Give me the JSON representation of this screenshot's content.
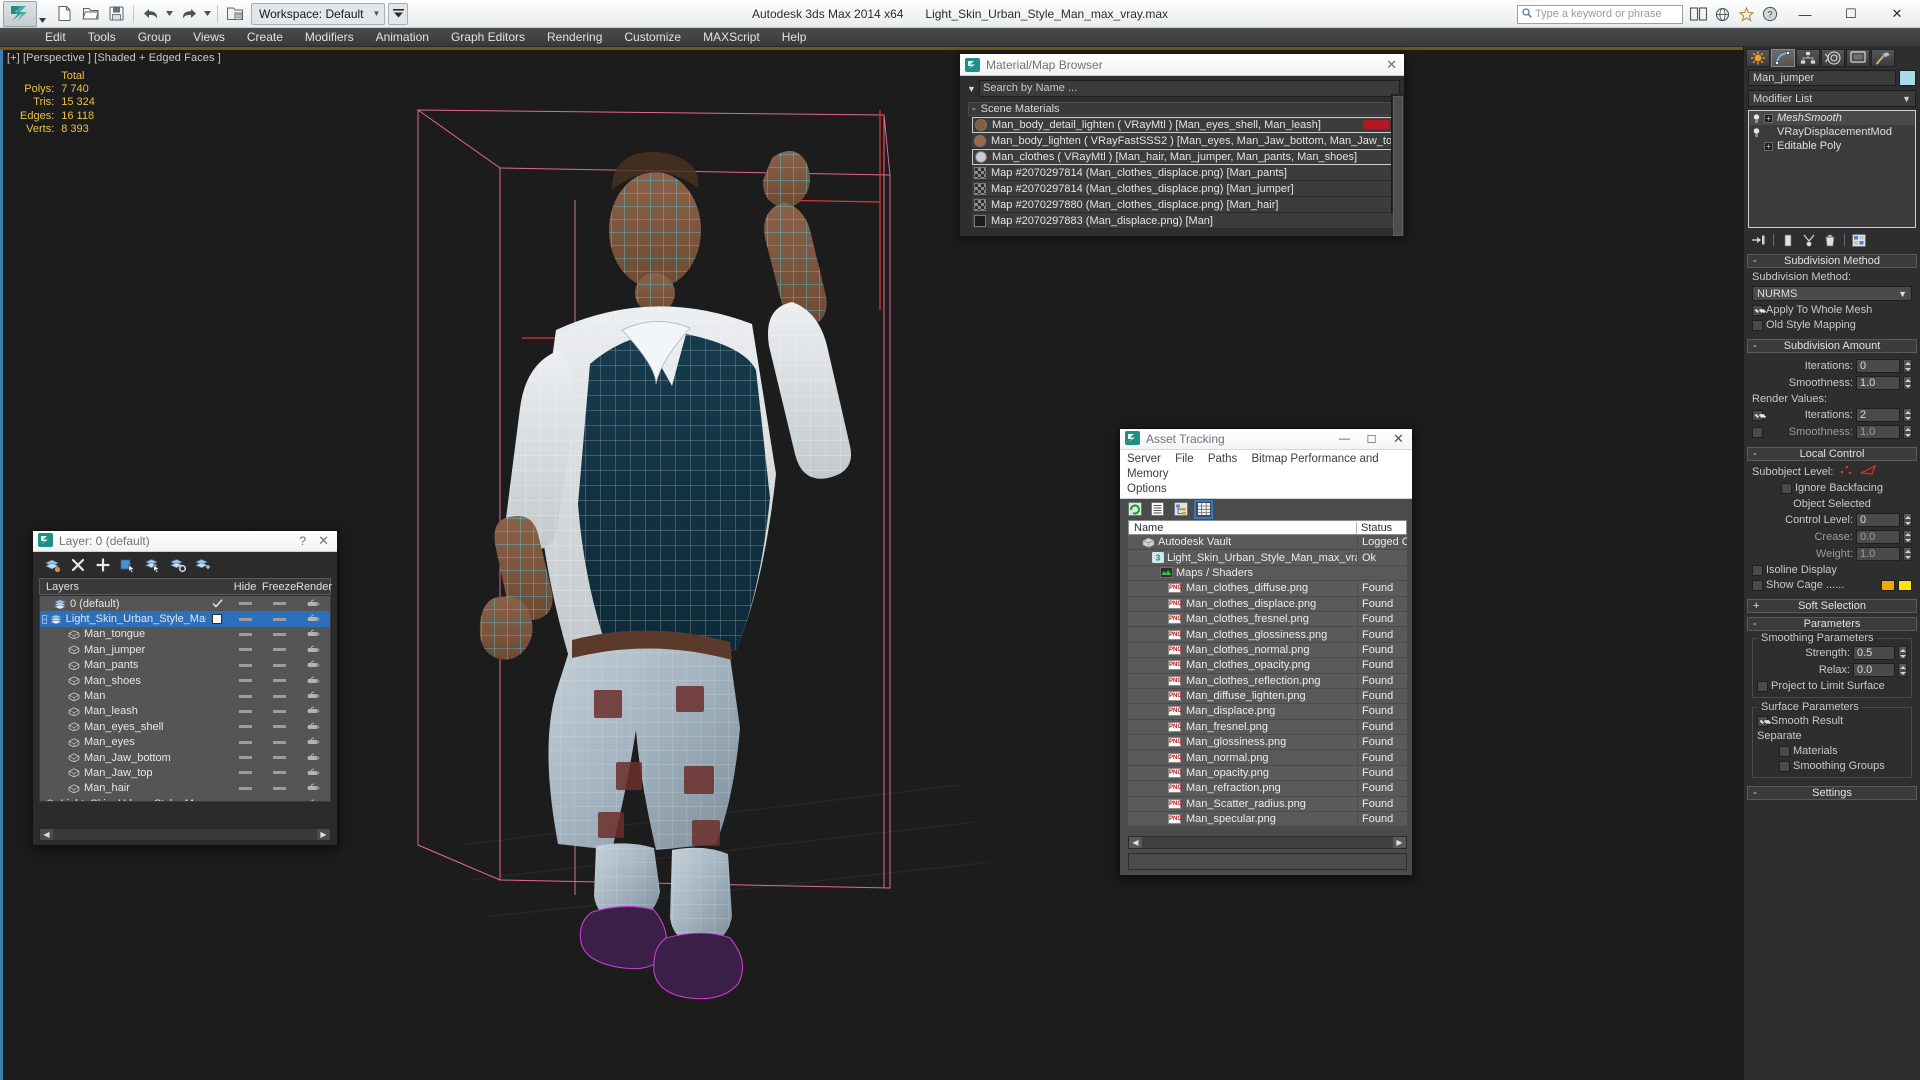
{
  "titlebar": {
    "workspace_label": "Workspace: Default",
    "app_title": "Autodesk 3ds Max  2014 x64",
    "file_title": "Light_Skin_Urban_Style_Man_max_vray.max",
    "search_placeholder": "Type a keyword or phrase",
    "minimize": "—",
    "maximize": "☐",
    "close": "✕"
  },
  "menubar": {
    "items": [
      "Edit",
      "Tools",
      "Group",
      "Views",
      "Create",
      "Modifiers",
      "Animation",
      "Graph Editors",
      "Rendering",
      "Customize",
      "MAXScript",
      "Help"
    ]
  },
  "viewport": {
    "label": "[+] [Perspective ] [Shaded + Edged Faces ]",
    "stats_header": "Total",
    "stats": [
      {
        "label": "Polys:",
        "value": "7 740"
      },
      {
        "label": "Tris:",
        "value": "15 324"
      },
      {
        "label": "Edges:",
        "value": "16 118"
      },
      {
        "label": "Verts:",
        "value": "8 393"
      }
    ]
  },
  "material_browser": {
    "title": "Material/Map Browser",
    "close": "✕",
    "search_placeholder": "Search by Name ...",
    "group_label": "Scene Materials",
    "group_marker": "-",
    "items": [
      {
        "name": "Man_body_detail_lighten  ( VRayMtl ) [Man_eyes_shell, Man_leash]",
        "swatch": "#8a5a3c",
        "selected": false
      },
      {
        "name": "Man_body_lighten  ( VRayFastSSS2 ) [Man_eyes, Man_Jaw_bottom, Man_Jaw_top, Ma..",
        "swatch": "#9a6845",
        "selected": false
      },
      {
        "name": "Man_clothes  ( VRayMtl ) [Man_hair, Man_jumper, Man_pants, Man_shoes]",
        "swatch": "#c9cdd2",
        "selected": true
      },
      {
        "name": "Map #2070297814 (Man_clothes_displace.png) [Man_pants]",
        "swatch": "#6e6e6e",
        "selected": false
      },
      {
        "name": "Map #2070297814 (Man_clothes_displace.png) [Man_jumper]",
        "swatch": "#6e6e6e",
        "selected": false
      },
      {
        "name": "Map #2070297880 (Man_clothes_displace.png) [Man_hair]",
        "swatch": "#6e6e6e",
        "selected": false
      },
      {
        "name": "Map #2070297883 (Man_displace.png) [Man]",
        "swatch": "#242424",
        "selected": false
      }
    ]
  },
  "layer_window": {
    "title": "Layer: 0 (default)",
    "help": "?",
    "close": "✕",
    "columns": {
      "layers": "Layers",
      "hide": "Hide",
      "freeze": "Freeze",
      "render": "Render"
    },
    "rows": [
      {
        "name": "0 (default)",
        "indent": 1,
        "type": "layer",
        "check": "check",
        "selected": false,
        "expander": ""
      },
      {
        "name": "Light_Skin_Urban_Style_Man",
        "indent": 1,
        "type": "layer",
        "check": "box",
        "selected": true,
        "expander": "-"
      },
      {
        "name": "Man_tongue",
        "indent": 2,
        "type": "object",
        "check": "",
        "selected": false,
        "expander": ""
      },
      {
        "name": "Man_jumper",
        "indent": 2,
        "type": "object",
        "check": "",
        "selected": false,
        "expander": ""
      },
      {
        "name": "Man_pants",
        "indent": 2,
        "type": "object",
        "check": "",
        "selected": false,
        "expander": ""
      },
      {
        "name": "Man_shoes",
        "indent": 2,
        "type": "object",
        "check": "",
        "selected": false,
        "expander": ""
      },
      {
        "name": "Man",
        "indent": 2,
        "type": "object",
        "check": "",
        "selected": false,
        "expander": ""
      },
      {
        "name": "Man_leash",
        "indent": 2,
        "type": "object",
        "check": "",
        "selected": false,
        "expander": ""
      },
      {
        "name": "Man_eyes_shell",
        "indent": 2,
        "type": "object",
        "check": "",
        "selected": false,
        "expander": ""
      },
      {
        "name": "Man_eyes",
        "indent": 2,
        "type": "object",
        "check": "",
        "selected": false,
        "expander": ""
      },
      {
        "name": "Man_Jaw_bottom",
        "indent": 2,
        "type": "object",
        "check": "",
        "selected": false,
        "expander": ""
      },
      {
        "name": "Man_Jaw_top",
        "indent": 2,
        "type": "object",
        "check": "",
        "selected": false,
        "expander": ""
      },
      {
        "name": "Man_hair",
        "indent": 2,
        "type": "object",
        "check": "",
        "selected": false,
        "expander": ""
      },
      {
        "name": "Light_Skin_Urban_Style_Man",
        "indent": 2,
        "type": "object",
        "check": "",
        "selected": false,
        "expander": ""
      }
    ]
  },
  "asset_tracking": {
    "title": "Asset Tracking",
    "minimize": "—",
    "maximize": "☐",
    "close": "✕",
    "menu": [
      "Server",
      "File",
      "Paths",
      "Bitmap Performance and Memory",
      "Options"
    ],
    "columns": {
      "name": "Name",
      "status": "Status"
    },
    "rows": [
      {
        "name": "Autodesk Vault",
        "status": "Logged O",
        "indent": 1,
        "icon": "vault"
      },
      {
        "name": "Light_Skin_Urban_Style_Man_max_vray.max",
        "status": "Ok",
        "indent": 2,
        "icon": "max"
      },
      {
        "name": "Maps / Shaders",
        "status": "",
        "indent": 3,
        "icon": "maps"
      },
      {
        "name": "Man_clothes_diffuse.png",
        "status": "Found",
        "indent": 4,
        "icon": "png"
      },
      {
        "name": "Man_clothes_displace.png",
        "status": "Found",
        "indent": 4,
        "icon": "png"
      },
      {
        "name": "Man_clothes_fresnel.png",
        "status": "Found",
        "indent": 4,
        "icon": "png"
      },
      {
        "name": "Man_clothes_glossiness.png",
        "status": "Found",
        "indent": 4,
        "icon": "png"
      },
      {
        "name": "Man_clothes_normal.png",
        "status": "Found",
        "indent": 4,
        "icon": "png"
      },
      {
        "name": "Man_clothes_opacity.png",
        "status": "Found",
        "indent": 4,
        "icon": "png"
      },
      {
        "name": "Man_clothes_reflection.png",
        "status": "Found",
        "indent": 4,
        "icon": "png"
      },
      {
        "name": "Man_diffuse_lighten.png",
        "status": "Found",
        "indent": 4,
        "icon": "png"
      },
      {
        "name": "Man_displace.png",
        "status": "Found",
        "indent": 4,
        "icon": "png"
      },
      {
        "name": "Man_fresnel.png",
        "status": "Found",
        "indent": 4,
        "icon": "png"
      },
      {
        "name": "Man_glossiness.png",
        "status": "Found",
        "indent": 4,
        "icon": "png"
      },
      {
        "name": "Man_normal.png",
        "status": "Found",
        "indent": 4,
        "icon": "png"
      },
      {
        "name": "Man_opacity.png",
        "status": "Found",
        "indent": 4,
        "icon": "png"
      },
      {
        "name": "Man_refraction.png",
        "status": "Found",
        "indent": 4,
        "icon": "png"
      },
      {
        "name": "Man_Scatter_radius.png",
        "status": "Found",
        "indent": 4,
        "icon": "png"
      },
      {
        "name": "Man_specular.png",
        "status": "Found",
        "indent": 4,
        "icon": "png"
      }
    ]
  },
  "command_panel": {
    "object_name": "Man_jumper",
    "object_color": "#a7dbe6",
    "modifier_list_label": "Modifier List",
    "stack": [
      {
        "name": "MeshSmooth",
        "italic": true,
        "has_plus": true,
        "selected": true
      },
      {
        "name": "VRayDisplacementMod",
        "italic": false,
        "has_plus": false,
        "selected": false
      },
      {
        "name": "Editable Poly",
        "italic": false,
        "has_plus": true,
        "selected": false
      }
    ],
    "subdivision_method": {
      "title": "Subdivision Method",
      "marker": "-",
      "label": "Subdivision Method:",
      "value": "NURMS",
      "apply_whole_mesh": {
        "label": "Apply To Whole Mesh",
        "checked": true
      },
      "old_style_mapping": {
        "label": "Old Style Mapping",
        "checked": false
      }
    },
    "subdivision_amount": {
      "title": "Subdivision Amount",
      "marker": "-",
      "iterations_label": "Iterations:",
      "iterations_value": "0",
      "smoothness_label": "Smoothness:",
      "smoothness_value": "1.0",
      "render_values_label": "Render Values:",
      "render_iterations_label": "Iterations:",
      "render_iterations_value": "2",
      "render_iterations_checked": true,
      "render_smoothness_label": "Smoothness:",
      "render_smoothness_value": "1.0",
      "render_smoothness_checked": false
    },
    "local_control": {
      "title": "Local Control",
      "marker": "-",
      "subobject_label": "Subobject Level:",
      "ignore_backfacing": {
        "label": "Ignore Backfacing",
        "checked": false
      },
      "object_selected": "Object Selected",
      "control_level_label": "Control Level:",
      "control_level_value": "0",
      "crease_label": "Crease:",
      "crease_value": "0.0",
      "weight_label": "Weight:",
      "weight_value": "1.0",
      "isoline_display": {
        "label": "Isoline Display",
        "checked": false
      },
      "show_cage": {
        "label": "Show Cage ......",
        "checked": false,
        "color1": "#f2a400",
        "color2": "#fbe400"
      }
    },
    "soft_selection": {
      "title": "Soft Selection",
      "marker": "+"
    },
    "parameters": {
      "title": "Parameters",
      "marker": "-",
      "smoothing_group_label": "Smoothing Parameters",
      "strength_label": "Strength:",
      "strength_value": "0.5",
      "relax_label": "Relax:",
      "relax_value": "0.0",
      "project_limit": {
        "label": "Project to Limit Surface",
        "checked": false
      },
      "surface_group_label": "Surface Parameters",
      "smooth_result": {
        "label": "Smooth Result",
        "checked": true
      },
      "separate_label": "Separate",
      "materials": {
        "label": "Materials",
        "checked": false
      },
      "smoothing_groups": {
        "label": "Smoothing Groups",
        "checked": false
      }
    },
    "settings": {
      "title": "Settings",
      "marker": "-"
    }
  }
}
